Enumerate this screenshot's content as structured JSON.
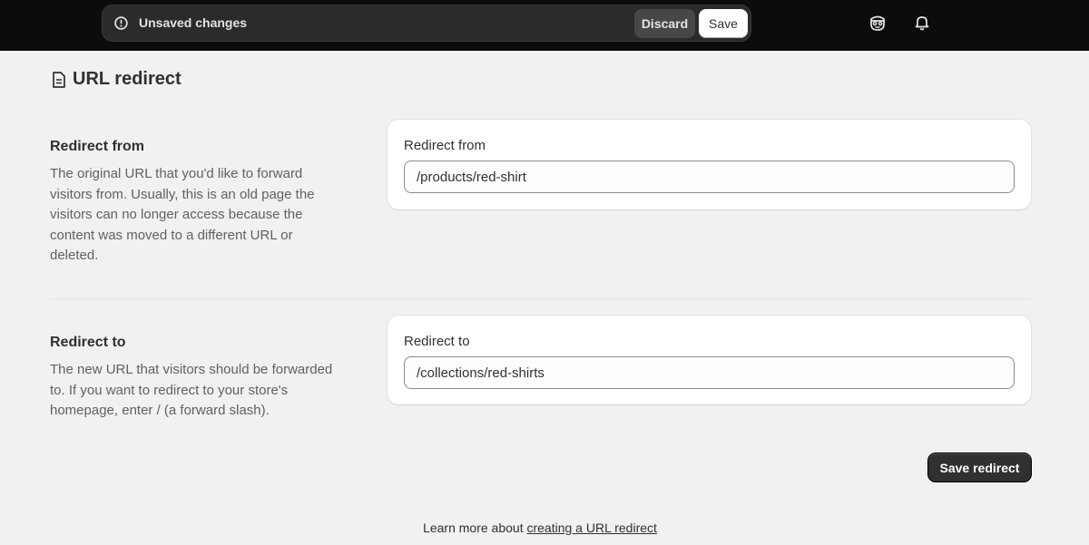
{
  "savebar": {
    "message": "Unsaved changes",
    "discard_label": "Discard",
    "save_label": "Save"
  },
  "topbar_icons": [
    "user-avatar-icon",
    "bell-icon"
  ],
  "page": {
    "title": "URL redirect",
    "title_icon": "document-icon"
  },
  "sections": [
    {
      "title": "Redirect from",
      "description": "The original URL that you'd like to forward visitors from. Usually, this is an old page the visitors can no longer access because the content was moved to a different URL or deleted.",
      "field_label": "Redirect from",
      "field_value": "/products/red-shirt"
    },
    {
      "title": "Redirect to",
      "description": "The new URL that visitors should be forwarded to. If you want to redirect to your store's homepage, enter / (a forward slash).",
      "field_label": "Redirect to",
      "field_value": "/collections/red-shirts"
    }
  ],
  "actions": {
    "save_redirect_label": "Save redirect"
  },
  "footer": {
    "prefix": "Learn more about",
    "link_text": "creating a URL redirect"
  },
  "colors": {
    "topbar": "#0c0c0c",
    "primary_button": "#303030",
    "page_background": "#f1f1f1"
  }
}
